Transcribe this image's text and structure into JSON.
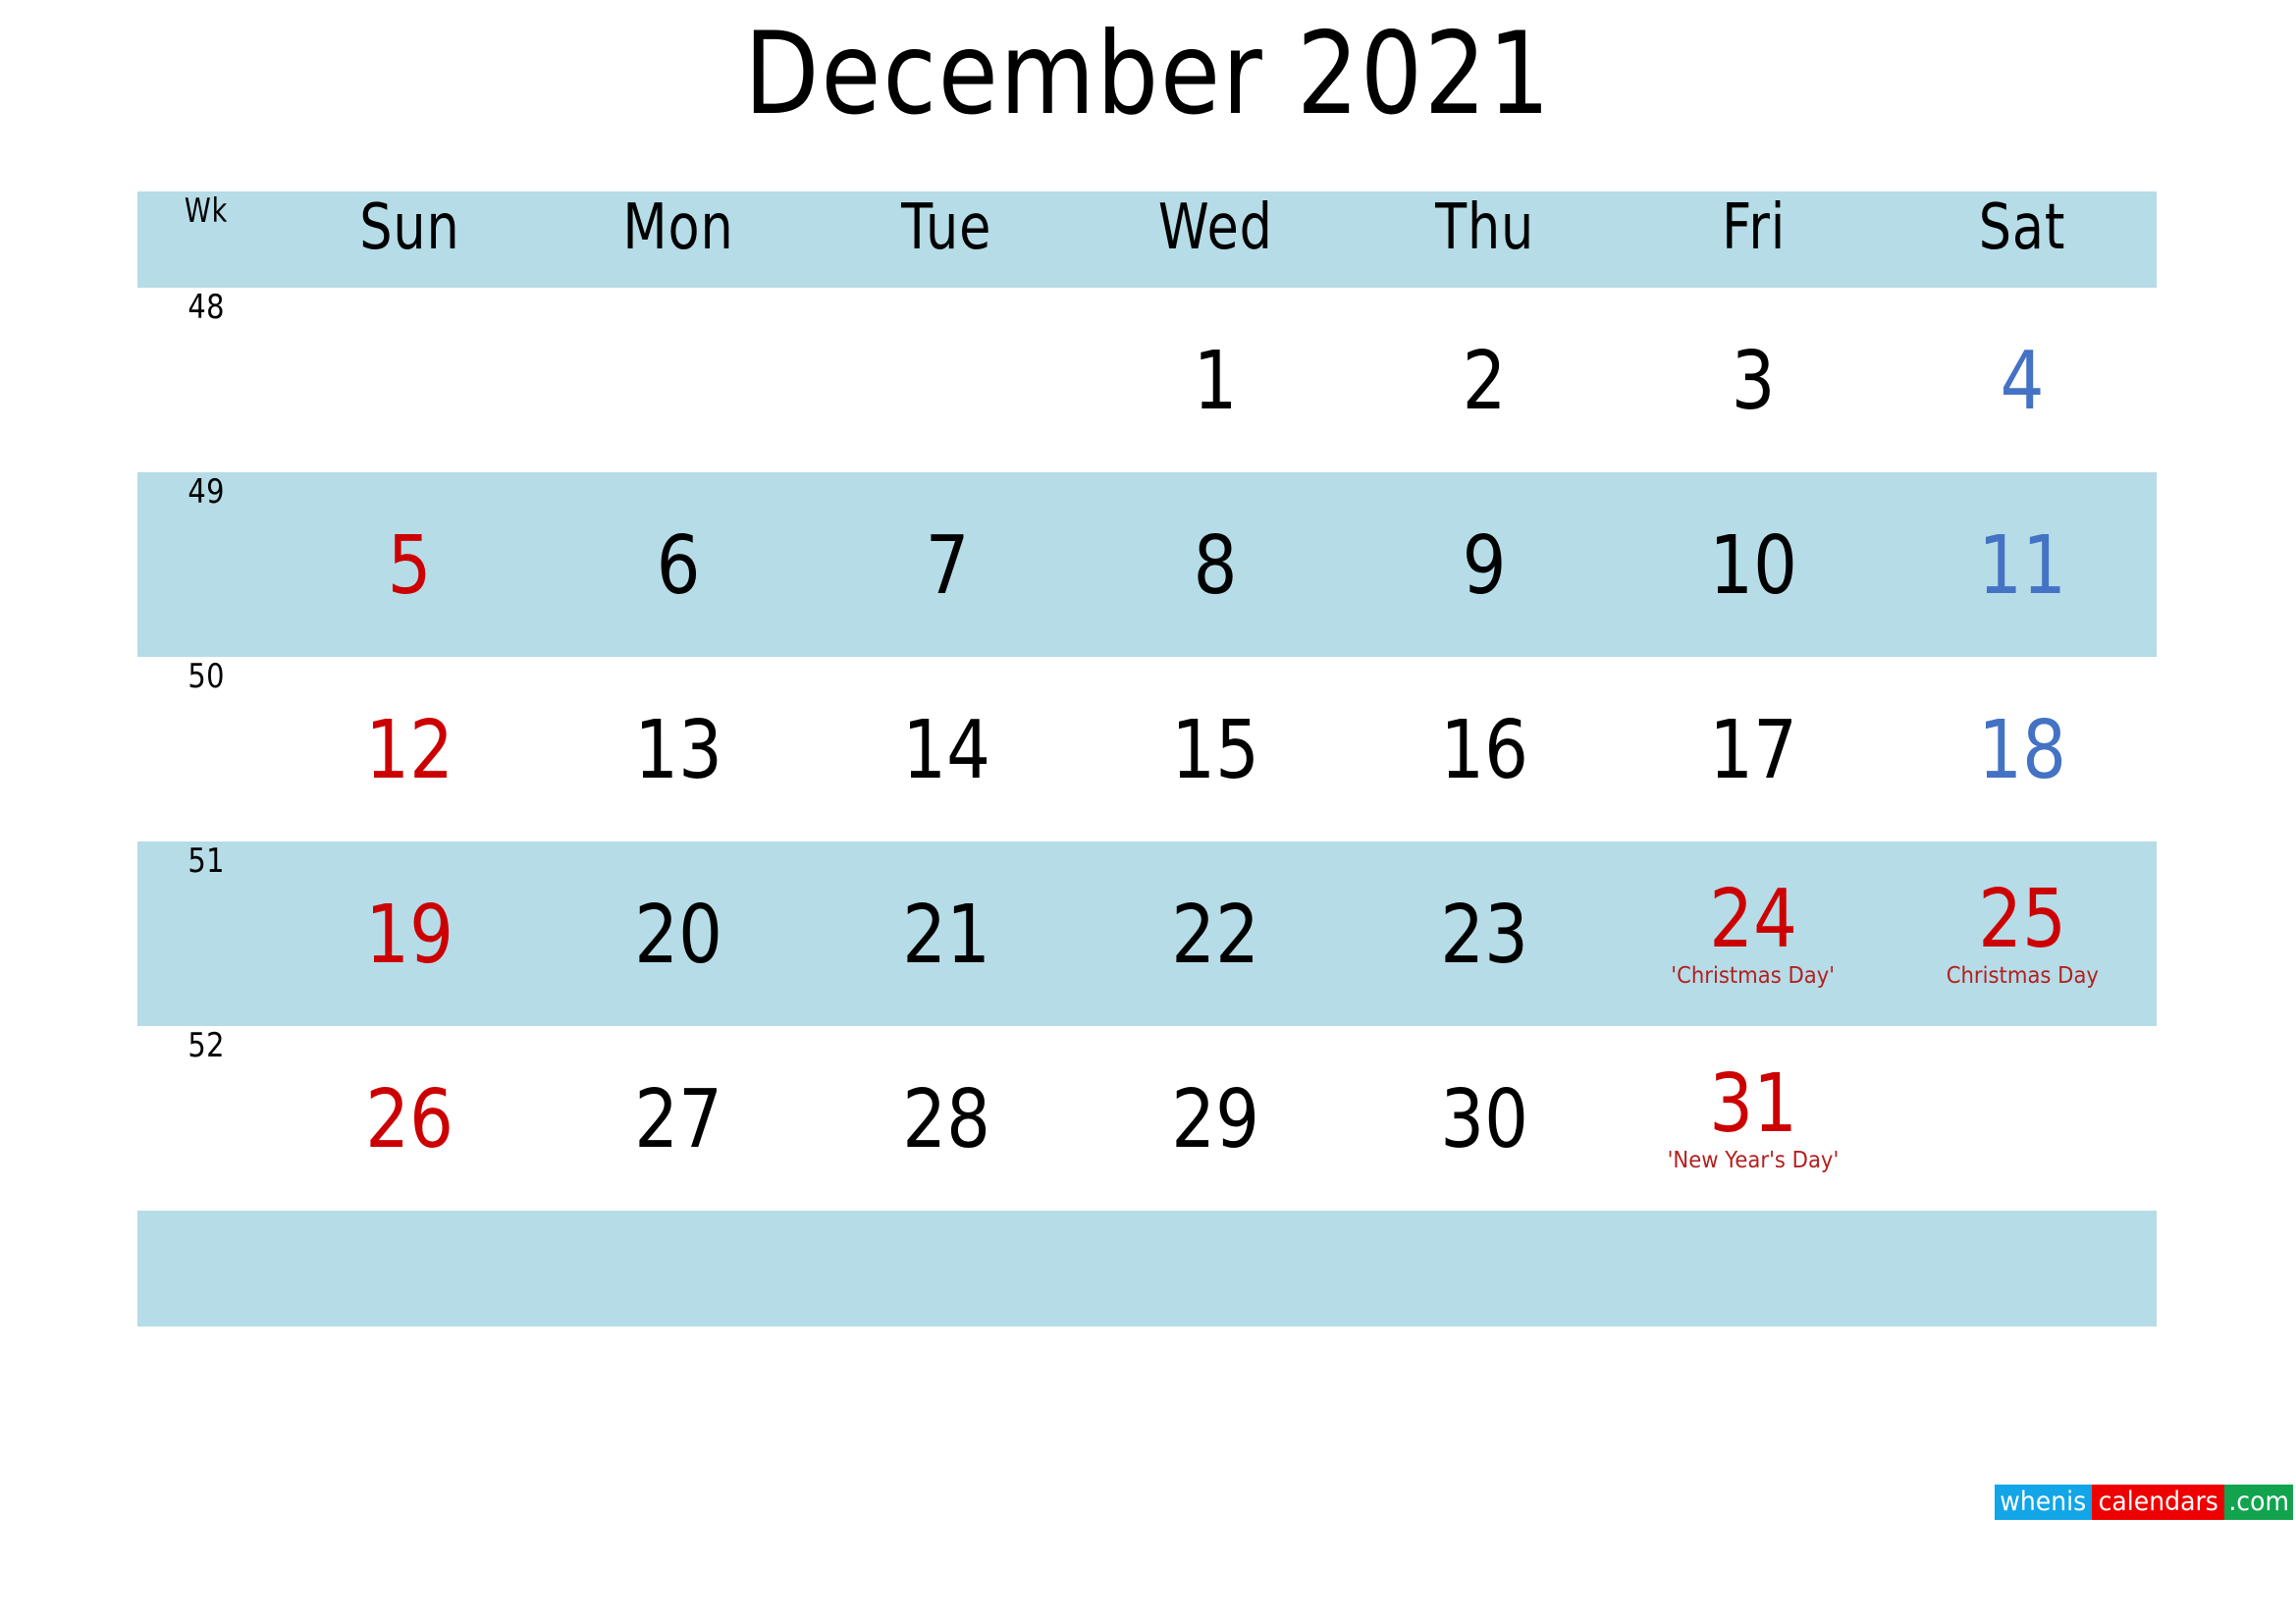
{
  "title": "December 2021",
  "colors": {
    "shade": "#B5DCE7",
    "sunday": "#CC0000",
    "saturday": "#4472C4",
    "weekday": "#000000",
    "holiday_note": "#B32020",
    "logo_blue": "#12A5E8",
    "logo_red": "#EE0000",
    "logo_green": "#12A34F"
  },
  "header": {
    "wk": "Wk",
    "days": [
      "Sun",
      "Mon",
      "Tue",
      "Wed",
      "Thu",
      "Fri",
      "Sat"
    ]
  },
  "weeks": [
    {
      "wk": "48",
      "shaded": false,
      "days": [
        {
          "num": "",
          "note": "",
          "kind": "empty"
        },
        {
          "num": "",
          "note": "",
          "kind": "empty"
        },
        {
          "num": "",
          "note": "",
          "kind": "empty"
        },
        {
          "num": "1",
          "note": "",
          "kind": "weekday"
        },
        {
          "num": "2",
          "note": "",
          "kind": "weekday"
        },
        {
          "num": "3",
          "note": "",
          "kind": "weekday"
        },
        {
          "num": "4",
          "note": "",
          "kind": "sat"
        }
      ]
    },
    {
      "wk": "49",
      "shaded": true,
      "days": [
        {
          "num": "5",
          "note": "",
          "kind": "sun"
        },
        {
          "num": "6",
          "note": "",
          "kind": "weekday"
        },
        {
          "num": "7",
          "note": "",
          "kind": "weekday"
        },
        {
          "num": "8",
          "note": "",
          "kind": "weekday"
        },
        {
          "num": "9",
          "note": "",
          "kind": "weekday"
        },
        {
          "num": "10",
          "note": "",
          "kind": "weekday"
        },
        {
          "num": "11",
          "note": "",
          "kind": "sat"
        }
      ]
    },
    {
      "wk": "50",
      "shaded": false,
      "days": [
        {
          "num": "12",
          "note": "",
          "kind": "sun"
        },
        {
          "num": "13",
          "note": "",
          "kind": "weekday"
        },
        {
          "num": "14",
          "note": "",
          "kind": "weekday"
        },
        {
          "num": "15",
          "note": "",
          "kind": "weekday"
        },
        {
          "num": "16",
          "note": "",
          "kind": "weekday"
        },
        {
          "num": "17",
          "note": "",
          "kind": "weekday"
        },
        {
          "num": "18",
          "note": "",
          "kind": "sat"
        }
      ]
    },
    {
      "wk": "51",
      "shaded": true,
      "days": [
        {
          "num": "19",
          "note": "",
          "kind": "sun"
        },
        {
          "num": "20",
          "note": "",
          "kind": "weekday"
        },
        {
          "num": "21",
          "note": "",
          "kind": "weekday"
        },
        {
          "num": "22",
          "note": "",
          "kind": "weekday"
        },
        {
          "num": "23",
          "note": "",
          "kind": "weekday"
        },
        {
          "num": "24",
          "note": "'Christmas Day'",
          "kind": "holiday"
        },
        {
          "num": "25",
          "note": "Christmas Day",
          "kind": "holiday"
        }
      ]
    },
    {
      "wk": "52",
      "shaded": false,
      "days": [
        {
          "num": "26",
          "note": "",
          "kind": "sun"
        },
        {
          "num": "27",
          "note": "",
          "kind": "weekday"
        },
        {
          "num": "28",
          "note": "",
          "kind": "weekday"
        },
        {
          "num": "29",
          "note": "",
          "kind": "weekday"
        },
        {
          "num": "30",
          "note": "",
          "kind": "weekday"
        },
        {
          "num": "31",
          "note": "'New Year's Day'",
          "kind": "holiday"
        },
        {
          "num": "",
          "note": "",
          "kind": "empty"
        }
      ]
    }
  ],
  "logo": {
    "part_blue": "whenis",
    "part_red": "calendars",
    "part_green": ".com"
  }
}
